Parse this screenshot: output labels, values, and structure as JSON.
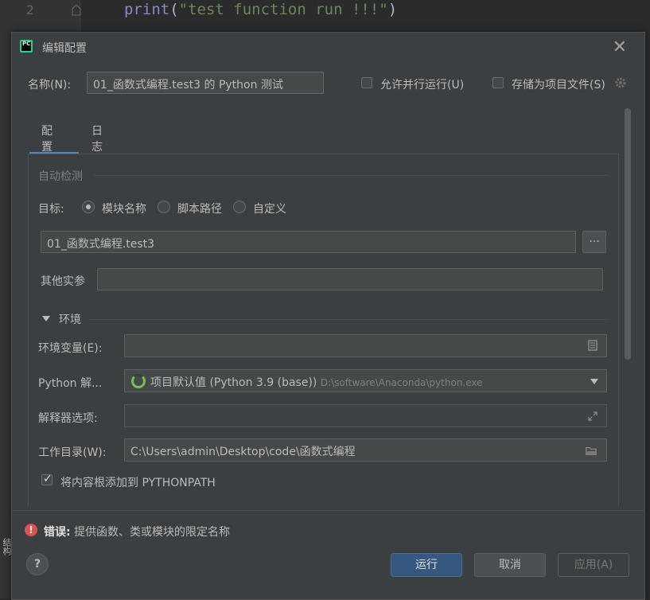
{
  "editor": {
    "line_number": "2",
    "code_fn": "print",
    "code_open": "(",
    "code_string": "\"test function run !!!\"",
    "code_close": ")"
  },
  "side_tab_label": "结构",
  "dialog": {
    "title": "编辑配置",
    "app_icon_text": "PC",
    "close_glyph": "✕",
    "name_label": "名称(N):",
    "name_value": "01_函数式编程.test3 的 Python 测试",
    "allow_parallel_label": "允许并行运行(U)",
    "allow_parallel_checked": false,
    "store_as_project_file_label": "存储为项目文件(S)",
    "store_as_project_file_checked": false,
    "tabs": [
      {
        "label": "配置",
        "active": true
      },
      {
        "label": "日志",
        "active": false
      }
    ],
    "config": {
      "auto_detect_title": "自动检测",
      "target_label": "目标:",
      "target_options": [
        {
          "label": "模块名称",
          "selected": true
        },
        {
          "label": "脚本路径",
          "selected": false
        },
        {
          "label": "自定义",
          "selected": false
        }
      ],
      "target_value": "01_函数式编程.test3",
      "browse_label": "...",
      "other_args_label": "其他实参",
      "other_args_value": "",
      "env_section_title": "环境",
      "env_vars_label": "环境变量(E):",
      "env_vars_value": "",
      "interpreter_label": "Python 解...",
      "interpreter_value": "项目默认值 (Python 3.9 (base))",
      "interpreter_path": "D:\\software\\Anaconda\\python.exe",
      "interpreter_options_label": "解释器选项:",
      "interpreter_options_value": "",
      "workdir_label": "工作目录(W):",
      "workdir_value": "C:\\Users\\admin\\Desktop\\code\\函数式编程",
      "add_content_roots_label": "将内容根添加到 PYTHONPATH",
      "add_content_roots_checked": true
    },
    "error": {
      "prefix": "错误:",
      "message": "提供函数、类或模块的限定名称"
    },
    "buttons": {
      "help": "?",
      "run": "运行",
      "cancel": "取消",
      "apply": "应用(A)"
    }
  },
  "colors": {
    "accent": "#4a88c7",
    "primary_button": "#365880",
    "error": "#d9534f",
    "spinner": "#7bbf4f"
  }
}
